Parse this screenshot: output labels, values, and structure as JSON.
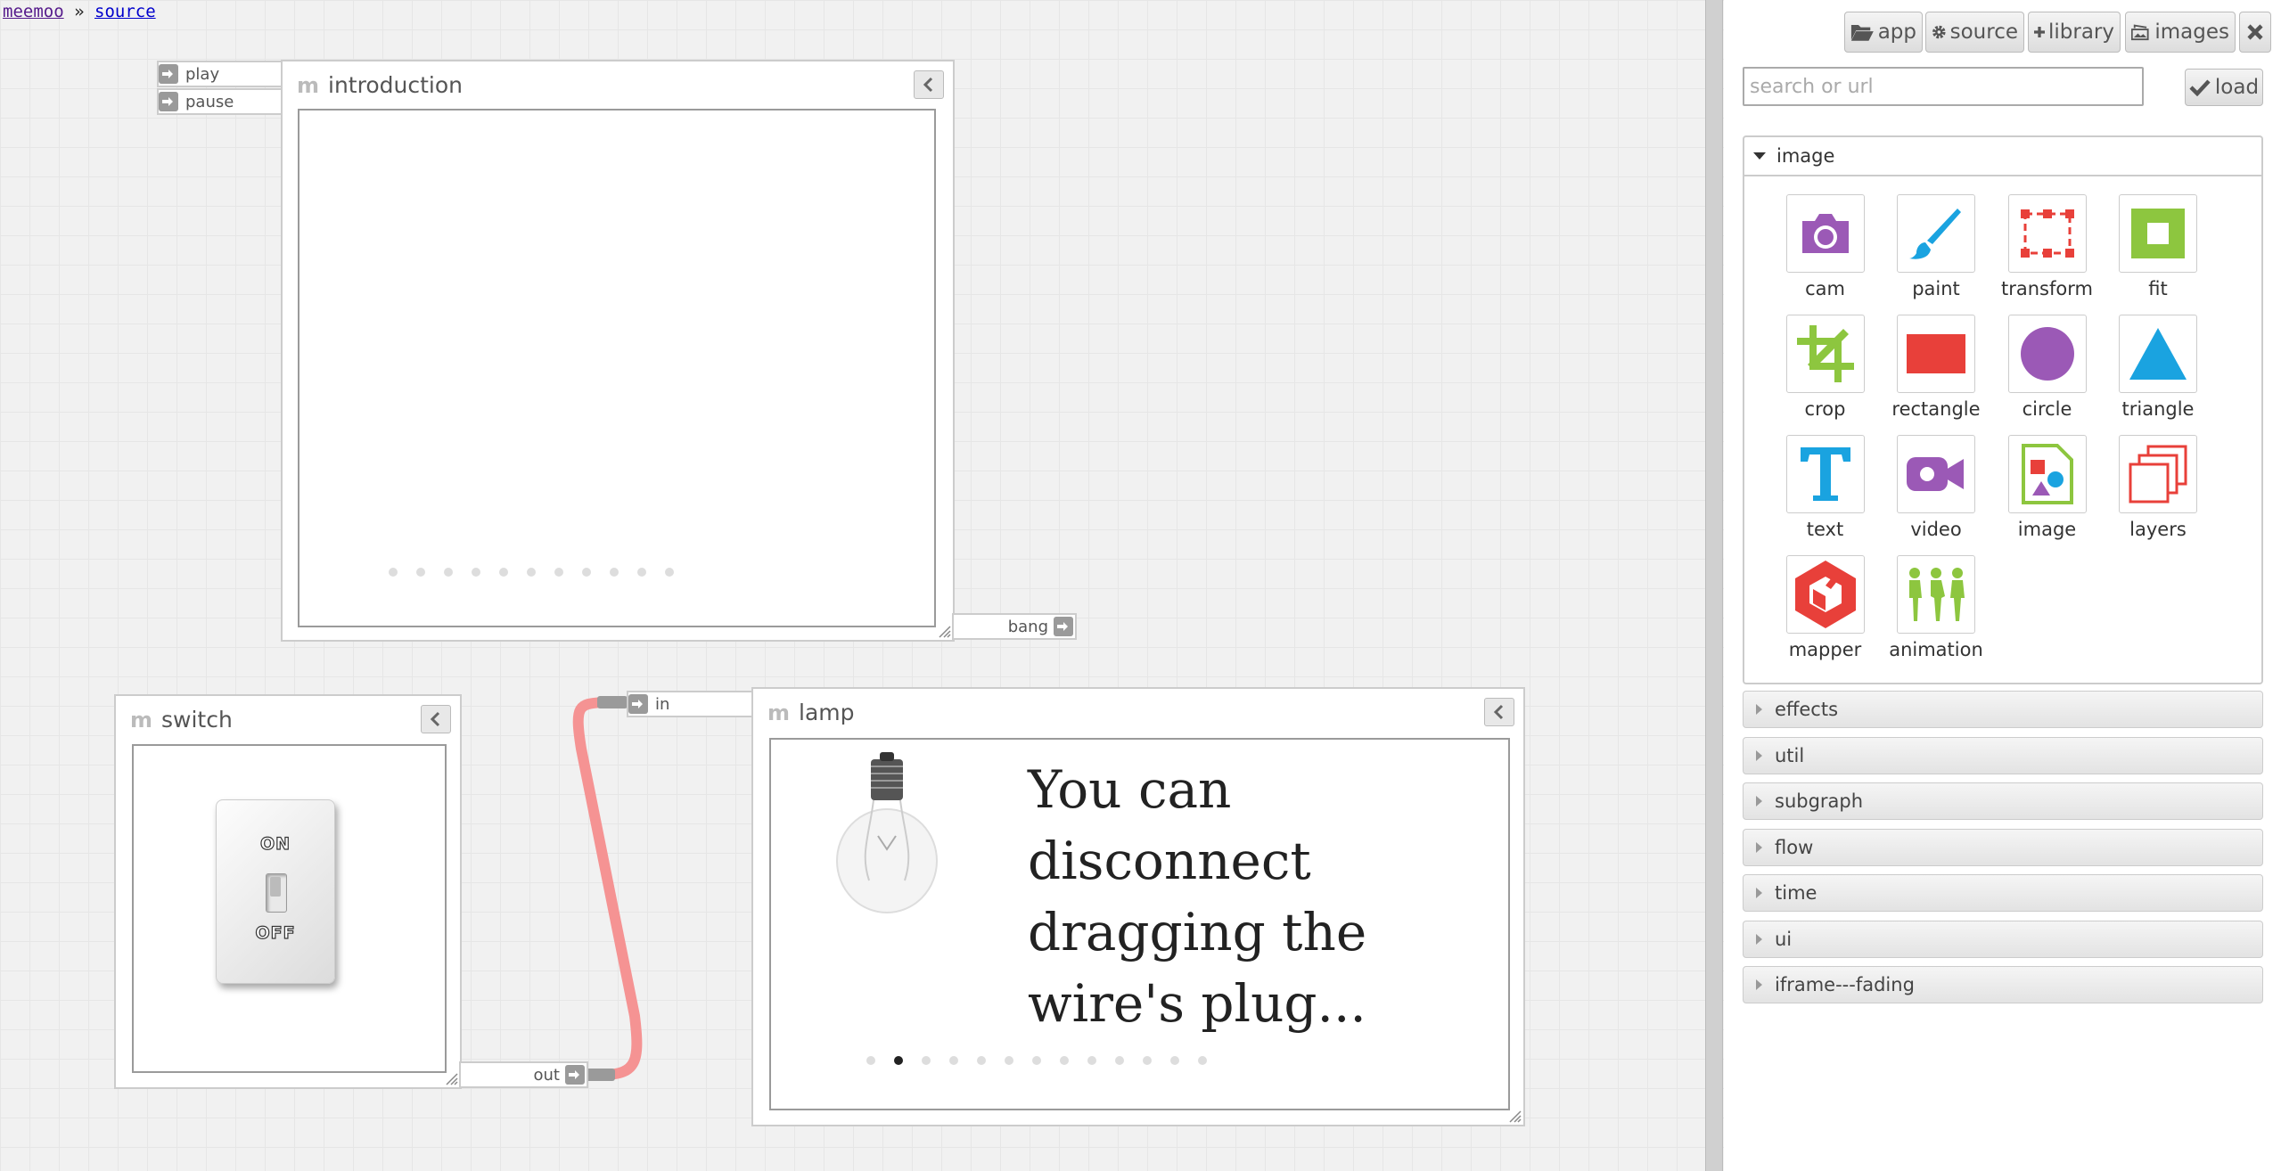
{
  "breadcrumb": {
    "home": "meemoo",
    "separator": "»",
    "current": "source"
  },
  "nodes": {
    "introduction": {
      "title": "introduction",
      "inputs": [
        "play",
        "pause"
      ],
      "output": "bang",
      "slides": {
        "count": 11,
        "active": -1
      }
    },
    "switch": {
      "title": "switch",
      "output": "out",
      "on_label": "ON",
      "off_label": "OFF"
    },
    "lamp": {
      "title": "lamp",
      "input": "in",
      "caption": "You can disconnect dragging the wire's plug...",
      "slides": {
        "count": 13,
        "active": 1
      }
    }
  },
  "toolbar": {
    "app": "app",
    "source": "source",
    "library": "library",
    "images": "images"
  },
  "search": {
    "placeholder": "search or url",
    "value": ""
  },
  "load_label": "load",
  "library": {
    "open_section": "image",
    "tiles": [
      {
        "label": "cam",
        "icon": "camera-icon"
      },
      {
        "label": "paint",
        "icon": "paintbrush-icon"
      },
      {
        "label": "transform",
        "icon": "transform-icon"
      },
      {
        "label": "fit",
        "icon": "fit-icon"
      },
      {
        "label": "crop",
        "icon": "crop-icon"
      },
      {
        "label": "rectangle",
        "icon": "rectangle-icon"
      },
      {
        "label": "circle",
        "icon": "circle-icon"
      },
      {
        "label": "triangle",
        "icon": "triangle-icon"
      },
      {
        "label": "text",
        "icon": "text-icon"
      },
      {
        "label": "video",
        "icon": "video-icon"
      },
      {
        "label": "image",
        "icon": "image-icon"
      },
      {
        "label": "layers",
        "icon": "layers-icon"
      },
      {
        "label": "mapper",
        "icon": "mapper-icon"
      },
      {
        "label": "animation",
        "icon": "animation-icon"
      }
    ],
    "closed_sections": [
      "effects",
      "util",
      "subgraph",
      "flow",
      "time",
      "ui",
      "iframe---fading"
    ]
  },
  "colors": {
    "purple": "#9b59b6",
    "blue": "#1aa3e0",
    "red": "#e8403a",
    "green": "#8dc63f",
    "wire": "#f59393"
  }
}
